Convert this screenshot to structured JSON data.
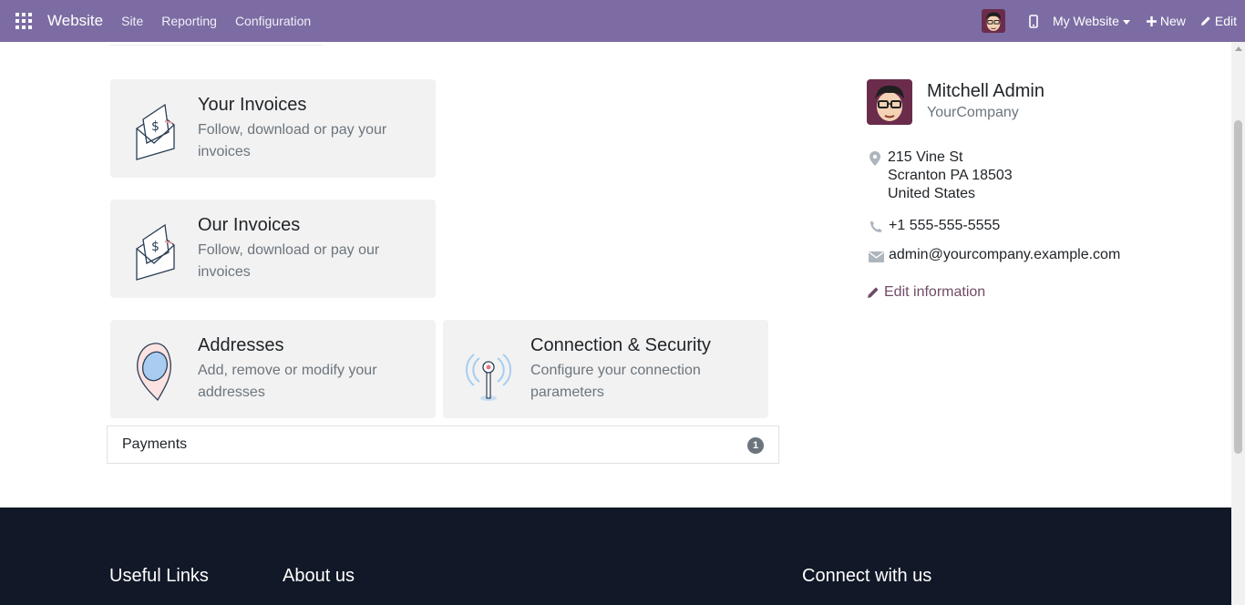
{
  "navbar": {
    "brand": "Website",
    "menu": [
      "Site",
      "Reporting",
      "Configuration"
    ],
    "website_selector": "My Website",
    "new_label": "New",
    "edit_label": "Edit",
    "bg_color": "#7c6ca3"
  },
  "cards": [
    {
      "title": "Your Invoices",
      "description": "Follow, download or pay your invoices",
      "icon": "invoice-envelope-icon"
    },
    {
      "title": "Our Invoices",
      "description": "Follow, download or pay our invoices",
      "icon": "invoice-envelope-icon"
    },
    {
      "title": "Addresses",
      "description": "Add, remove or modify your addresses",
      "icon": "map-pin-icon"
    },
    {
      "title": "Connection & Security",
      "description": "Configure your connection parameters",
      "icon": "antenna-icon"
    }
  ],
  "payments": {
    "label": "Payments",
    "count": "1"
  },
  "profile": {
    "name": "Mitchell Admin",
    "company": "YourCompany",
    "address": [
      "215 Vine St",
      "Scranton PA 18503",
      "United States"
    ],
    "phone": "+1 555-555-5555",
    "email": "admin@yourcompany.example.com",
    "edit_label": "Edit information"
  },
  "footer": {
    "headings": [
      "Useful Links",
      "About us",
      "Connect with us"
    ],
    "bg_color": "#111827"
  }
}
